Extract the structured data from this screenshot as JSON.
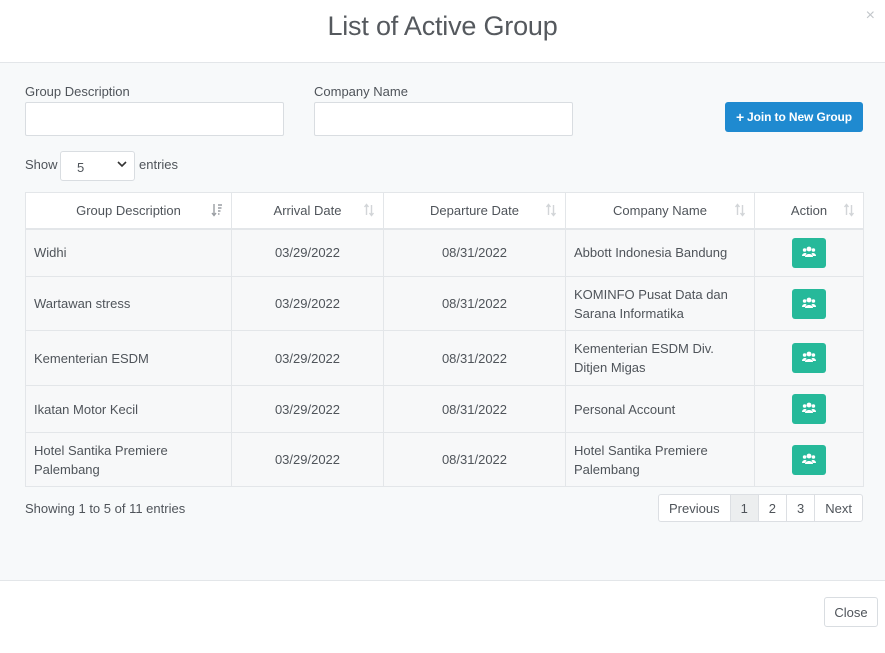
{
  "modal": {
    "title": "List of Active Group",
    "close_glyph": "×"
  },
  "filters": {
    "group_description_label": "Group Description",
    "group_description_value": "",
    "company_name_label": "Company Name",
    "company_name_value": ""
  },
  "join_button": {
    "icon": "plus-icon",
    "label": "Join to New Group",
    "color": "#1f8ad0"
  },
  "length_menu": {
    "show_label": "Show",
    "selected": "5",
    "entries_label": "entries"
  },
  "table": {
    "columns": [
      "Group Description",
      "Arrival Date",
      "Departure Date",
      "Company Name",
      "Action"
    ],
    "rows": [
      {
        "group": "Widhi",
        "arrival": "03/29/2022",
        "departure": "08/31/2022",
        "company": "Abbott Indonesia Bandung"
      },
      {
        "group": "Wartawan stress",
        "arrival": "03/29/2022",
        "departure": "08/31/2022",
        "company": "KOMINFO Pusat Data dan Sarana Informatika"
      },
      {
        "group": "Kementerian ESDM",
        "arrival": "03/29/2022",
        "departure": "08/31/2022",
        "company": "Kementerian ESDM Div. Ditjen Migas"
      },
      {
        "group": "Ikatan Motor Kecil",
        "arrival": "03/29/2022",
        "departure": "08/31/2022",
        "company": "Personal Account"
      },
      {
        "group": "Hotel Santika Premiere Palembang",
        "arrival": "03/29/2022",
        "departure": "08/31/2022",
        "company": "Hotel Santika Premiere Palembang"
      }
    ],
    "action_icon": "users-icon",
    "action_color": "#26b99a"
  },
  "info": "Showing 1 to 5 of 11 entries",
  "pagination": {
    "previous": "Previous",
    "pages": [
      "1",
      "2",
      "3"
    ],
    "active_page": "1",
    "next": "Next"
  },
  "footer": {
    "close_label": "Close"
  }
}
